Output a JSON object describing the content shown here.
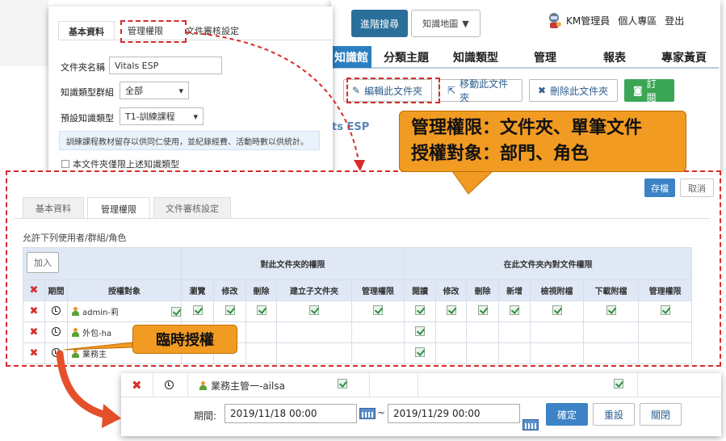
{
  "header": {
    "advanced_search": "進階搜尋",
    "knowledge_map": "知識地圖",
    "user_name": "KM管理員",
    "personal_area": "個人專區",
    "logout": "登出"
  },
  "nav": {
    "current": "知識館",
    "items": [
      "分類主題",
      "知識類型",
      "管理",
      "報表",
      "專家黃頁"
    ]
  },
  "toolbar": {
    "edit_folder": "編輯此文件夾",
    "move_folder": "移動此文件夾",
    "delete_folder": "刪除此文件夾",
    "subscribe": "訂閱"
  },
  "bg_glimpse": "ts ESP",
  "settings_panel": {
    "tabs": [
      "基本資料",
      "管理權限",
      "文件審核設定"
    ],
    "folder_name_label": "文件夾名稱",
    "folder_name_value": "Vitals ESP",
    "group_label": "知識類型群組",
    "group_value": "全部",
    "default_type_label": "預設知識類型",
    "default_type_value": "T1-訓練課程",
    "note": "訓練課程教材留存以供同仁使用，並紀錄經費、活動時數以供統計。",
    "restrict_label": "本文件夾僅限上述知識類型"
  },
  "callouts": {
    "line1": "管理權限：文件夾、單筆文件",
    "line2": "授權對象：部門、角色",
    "temp_auth": "臨時授權"
  },
  "permission": {
    "save": "存檔",
    "cancel": "取消",
    "tabs": [
      "基本資料",
      "管理權限",
      "文件審核設定"
    ],
    "subtitle": "允許下列使用者/群組/角色",
    "add": "加入",
    "group_folder": "對此文件夾的權限",
    "group_docs": "在此文件夾內對文件權限",
    "col_period": "期間",
    "col_target": "授權對象",
    "folder_cols": [
      "瀏覽",
      "修改",
      "刪除",
      "建立子文件夾",
      "管理權限"
    ],
    "doc_cols": [
      "閱讀",
      "修改",
      "刪除",
      "新增",
      "檢視附檔",
      "下載附檔",
      "管理權限"
    ],
    "rows": [
      {
        "name": "admin-莉",
        "folder": [
          true,
          true,
          true,
          true,
          true
        ],
        "docs": [
          true,
          true,
          true,
          true,
          true,
          true,
          true
        ]
      },
      {
        "name": "外包-ha",
        "folder": [
          false,
          false,
          false,
          false,
          false
        ],
        "docs": [
          true,
          false,
          false,
          false,
          false,
          false,
          false
        ]
      },
      {
        "name": "業務主",
        "folder": [
          false,
          false,
          false,
          false,
          false
        ],
        "docs": [
          true,
          false,
          false,
          false,
          false,
          false,
          false
        ]
      }
    ]
  },
  "zoom": {
    "user": "業務主管一-ailsa",
    "period_label": "期間:",
    "start": "2019/11/18 00:00",
    "tilde": "~",
    "end": "2019/11/29 00:00",
    "confirm": "確定",
    "reset": "重設",
    "close": "關閉"
  },
  "colors": {
    "callout": "#f29b22",
    "highlight_red": "#d92a2a",
    "primary_blue": "#3c83c5",
    "nav_blue": "#2a7fc0"
  }
}
